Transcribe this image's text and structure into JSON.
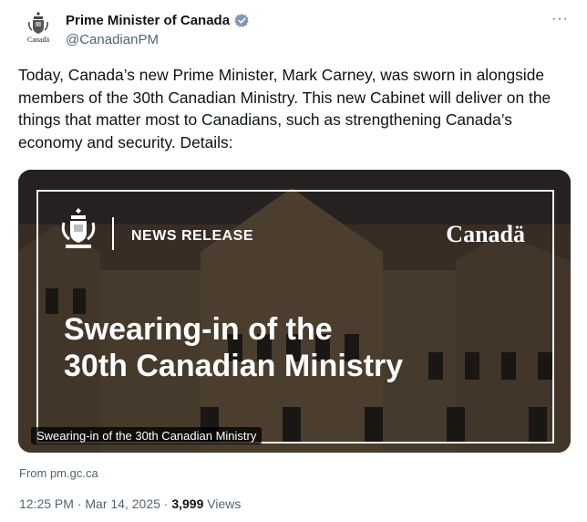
{
  "account": {
    "display_name": "Prime Minister of Canada",
    "handle": "@CanadianPM",
    "avatar_wordmark": "Canadä"
  },
  "more_label": "···",
  "tweet": {
    "text": "Today, Canada’s new Prime Minister, Mark Carney, was sworn in alongside members of the 30th Canadian Ministry. This new Cabinet will deliver on the things that matter most to Canadians, such as strengthening Canada’s economy and security. Details:"
  },
  "card": {
    "label": "NEWS RELEASE",
    "wordmark": "Canadä",
    "title_line1": "Swearing-in of the",
    "title_line2": "30th Canadian Ministry",
    "caption": "Swearing-in of the 30th Canadian Ministry"
  },
  "source": "From pm.gc.ca",
  "meta": {
    "time": "12:25 PM",
    "separator": "·",
    "date": "Mar 14, 2025",
    "views_count": "3,999",
    "views_label": "Views"
  },
  "colors": {
    "text": "#0f1419",
    "secondary": "#536471",
    "verified": "#829aab"
  }
}
